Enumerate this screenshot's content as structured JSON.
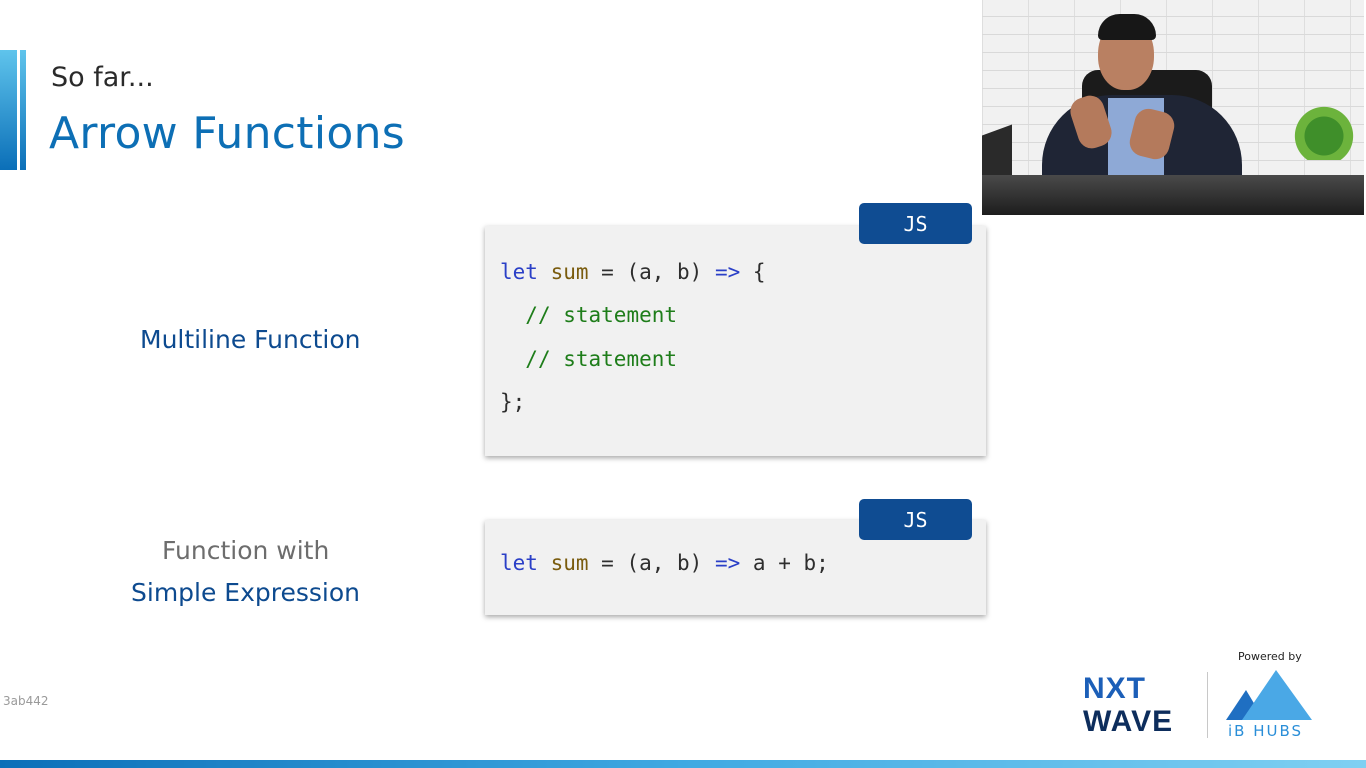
{
  "slide": {
    "subtitle": "So far...",
    "title": "Arrow Functions",
    "labels": {
      "multiline": "Multiline Function",
      "simple_line1": "Function with",
      "simple_line2": "Simple Expression"
    },
    "code_blocks": [
      {
        "badge": "JS",
        "lines": [
          [
            "let",
            " ",
            "sum",
            " = (a, b) ",
            "=>",
            " {"
          ],
          [
            "  ",
            "// statement"
          ],
          [
            "  ",
            "// statement"
          ],
          [
            "};"
          ]
        ]
      },
      {
        "badge": "JS",
        "lines": [
          [
            "let",
            " ",
            "sum",
            " = (a, b) ",
            "=>",
            " a + b;"
          ]
        ]
      }
    ]
  },
  "branding": {
    "powered_by": "Powered by",
    "nxt_line1": "NXT",
    "nxt_line2": "WAVE",
    "ib_hubs": "iB HUBS"
  },
  "watermark": "3ab442",
  "colors": {
    "accent": "#0d6fb5",
    "label_blue": "#0d4a8f",
    "badge": "#0f4c92",
    "keyword": "#2a3fc7",
    "identifier": "#7a5c0e",
    "comment": "#1e7d1a"
  }
}
